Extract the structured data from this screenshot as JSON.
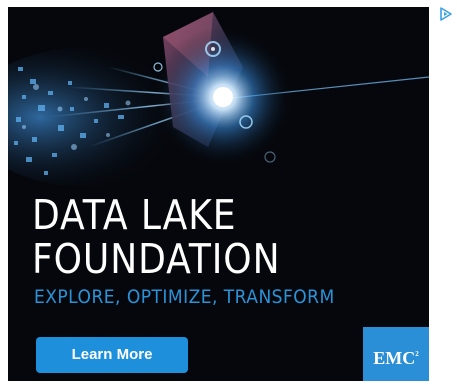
{
  "ad": {
    "headline_line1": "DATA LAKE",
    "headline_line2": "FOUNDATION",
    "tagline": "EXPLORE, OPTIMIZE, TRANSFORM",
    "cta_label": "Learn More",
    "logo_text": "EMC",
    "logo_superscript": "2"
  },
  "colors": {
    "background": "#05070c",
    "accent_blue": "#1e8fda",
    "tagline_blue": "#2a93d8",
    "headline_white": "#ffffff"
  },
  "icons": {
    "adchoices": "adchoices-triangle-icon"
  }
}
